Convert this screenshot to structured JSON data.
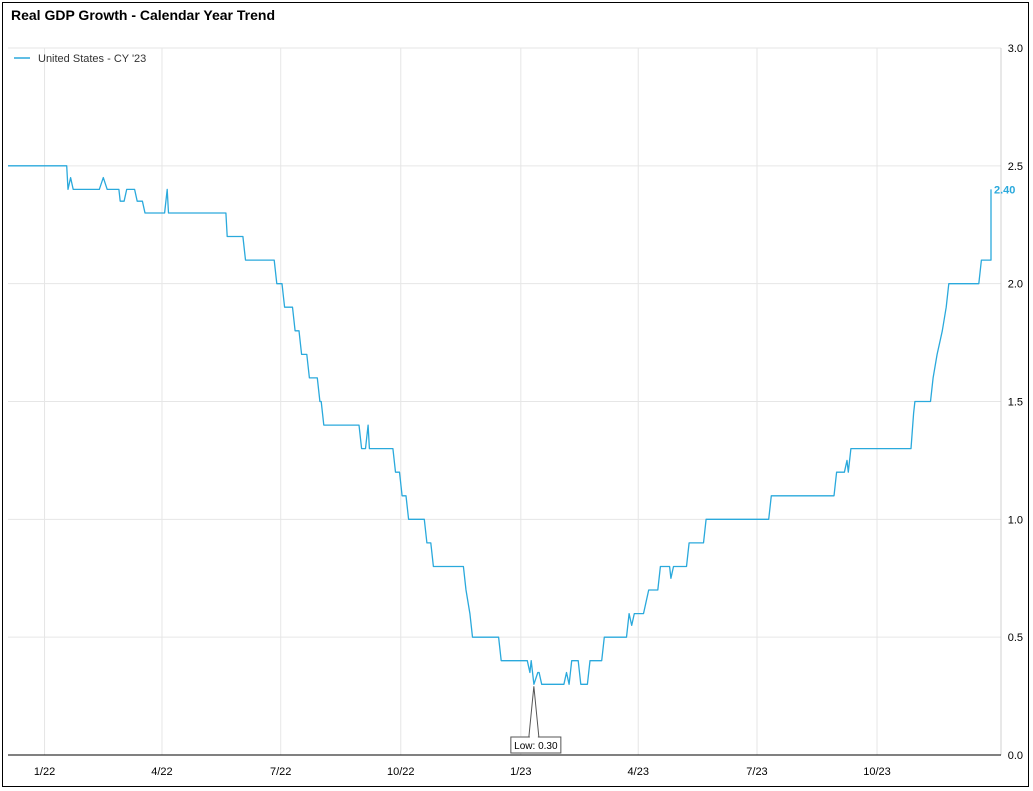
{
  "chart_data": {
    "type": "line",
    "title": "Real GDP Growth - Calendar Year Trend",
    "xlabel": "",
    "ylabel": "",
    "ylim": [
      0,
      3
    ],
    "yticks": [
      "0.0",
      "0.5",
      "1.0",
      "1.5",
      "2.0",
      "2.5",
      "3.0"
    ],
    "xticks": [
      "1/22",
      "4/22",
      "7/22",
      "10/22",
      "1/23",
      "4/23",
      "7/23",
      "10/23"
    ],
    "x_range": [
      "2021-12-04",
      "2024-01-04"
    ],
    "grid": true,
    "legend_position": "top-left",
    "series_color": "#2aa9dc",
    "series": [
      {
        "name": "United States - CY '23",
        "points": [
          [
            "2021-12-04",
            2.5
          ],
          [
            "2022-01-18",
            2.5
          ],
          [
            "2022-01-19",
            2.4
          ],
          [
            "2022-01-21",
            2.45
          ],
          [
            "2022-01-23",
            2.4
          ],
          [
            "2022-02-12",
            2.4
          ],
          [
            "2022-02-15",
            2.45
          ],
          [
            "2022-02-18",
            2.4
          ],
          [
            "2022-02-27",
            2.4
          ],
          [
            "2022-02-28",
            2.35
          ],
          [
            "2022-03-03",
            2.35
          ],
          [
            "2022-03-05",
            2.4
          ],
          [
            "2022-03-11",
            2.4
          ],
          [
            "2022-03-13",
            2.35
          ],
          [
            "2022-03-17",
            2.35
          ],
          [
            "2022-03-19",
            2.3
          ],
          [
            "2022-04-03",
            2.3
          ],
          [
            "2022-04-05",
            2.4
          ],
          [
            "2022-04-06",
            2.3
          ],
          [
            "2022-05-20",
            2.3
          ],
          [
            "2022-05-21",
            2.2
          ],
          [
            "2022-06-02",
            2.2
          ],
          [
            "2022-06-04",
            2.1
          ],
          [
            "2022-06-26",
            2.1
          ],
          [
            "2022-06-28",
            2.0
          ],
          [
            "2022-07-02",
            2.0
          ],
          [
            "2022-07-04",
            1.9
          ],
          [
            "2022-07-10",
            1.9
          ],
          [
            "2022-07-12",
            1.8
          ],
          [
            "2022-07-15",
            1.8
          ],
          [
            "2022-07-17",
            1.7
          ],
          [
            "2022-07-21",
            1.7
          ],
          [
            "2022-07-23",
            1.6
          ],
          [
            "2022-07-29",
            1.6
          ],
          [
            "2022-07-31",
            1.5
          ],
          [
            "2022-08-01",
            1.5
          ],
          [
            "2022-08-03",
            1.4
          ],
          [
            "2022-08-30",
            1.4
          ],
          [
            "2022-09-01",
            1.3
          ],
          [
            "2022-09-04",
            1.3
          ],
          [
            "2022-09-06",
            1.4
          ],
          [
            "2022-09-07",
            1.3
          ],
          [
            "2022-09-25",
            1.3
          ],
          [
            "2022-09-27",
            1.2
          ],
          [
            "2022-09-30",
            1.2
          ],
          [
            "2022-10-02",
            1.1
          ],
          [
            "2022-10-05",
            1.1
          ],
          [
            "2022-10-07",
            1.0
          ],
          [
            "2022-10-19",
            1.0
          ],
          [
            "2022-10-21",
            0.9
          ],
          [
            "2022-10-24",
            0.9
          ],
          [
            "2022-10-26",
            0.8
          ],
          [
            "2022-11-18",
            0.8
          ],
          [
            "2022-11-20",
            0.7
          ],
          [
            "2022-11-23",
            0.6
          ],
          [
            "2022-11-25",
            0.5
          ],
          [
            "2022-12-15",
            0.5
          ],
          [
            "2022-12-17",
            0.4
          ],
          [
            "2023-01-06",
            0.4
          ],
          [
            "2023-01-08",
            0.35
          ],
          [
            "2023-01-09",
            0.4
          ],
          [
            "2023-01-11",
            0.3
          ],
          [
            "2023-01-14",
            0.35
          ],
          [
            "2023-01-15",
            0.35
          ],
          [
            "2023-01-17",
            0.3
          ],
          [
            "2023-02-03",
            0.3
          ],
          [
            "2023-02-05",
            0.35
          ],
          [
            "2023-02-07",
            0.3
          ],
          [
            "2023-02-09",
            0.4
          ],
          [
            "2023-02-14",
            0.4
          ],
          [
            "2023-02-16",
            0.3
          ],
          [
            "2023-02-21",
            0.3
          ],
          [
            "2023-02-23",
            0.4
          ],
          [
            "2023-03-04",
            0.4
          ],
          [
            "2023-03-06",
            0.5
          ],
          [
            "2023-03-23",
            0.5
          ],
          [
            "2023-03-25",
            0.6
          ],
          [
            "2023-03-27",
            0.55
          ],
          [
            "2023-03-29",
            0.6
          ],
          [
            "2023-04-05",
            0.6
          ],
          [
            "2023-04-07",
            0.65
          ],
          [
            "2023-04-09",
            0.7
          ],
          [
            "2023-04-16",
            0.7
          ],
          [
            "2023-04-18",
            0.8
          ],
          [
            "2023-04-25",
            0.8
          ],
          [
            "2023-04-26",
            0.75
          ],
          [
            "2023-04-28",
            0.8
          ],
          [
            "2023-05-08",
            0.8
          ],
          [
            "2023-05-10",
            0.9
          ],
          [
            "2023-05-21",
            0.9
          ],
          [
            "2023-05-23",
            1.0
          ],
          [
            "2023-07-10",
            1.0
          ],
          [
            "2023-07-12",
            1.1
          ],
          [
            "2023-08-29",
            1.1
          ],
          [
            "2023-08-31",
            1.2
          ],
          [
            "2023-09-06",
            1.2
          ],
          [
            "2023-09-08",
            1.25
          ],
          [
            "2023-09-09",
            1.2
          ],
          [
            "2023-09-11",
            1.3
          ],
          [
            "2023-10-27",
            1.3
          ],
          [
            "2023-10-29",
            1.45
          ],
          [
            "2023-10-30",
            1.5
          ],
          [
            "2023-11-11",
            1.5
          ],
          [
            "2023-11-13",
            1.6
          ],
          [
            "2023-11-16",
            1.7
          ],
          [
            "2023-11-18",
            1.75
          ],
          [
            "2023-11-20",
            1.8
          ],
          [
            "2023-11-23",
            1.9
          ],
          [
            "2023-11-25",
            2.0
          ],
          [
            "2023-12-18",
            2.0
          ],
          [
            "2023-12-20",
            2.1
          ],
          [
            "2024-01-17",
            2.1
          ],
          [
            "2024-01-19",
            2.2
          ],
          [
            "2024-02-01",
            2.2
          ],
          [
            "2024-02-03",
            2.3
          ],
          [
            "2024-02-22",
            2.3
          ],
          [
            "2024-02-24",
            2.4
          ],
          [
            "2024-03-08",
            2.4
          ]
        ]
      }
    ],
    "last_value_label": "2.40",
    "annotation": {
      "text": "Low: 0.30",
      "x": "2023-01-11",
      "y": 0.3
    }
  }
}
